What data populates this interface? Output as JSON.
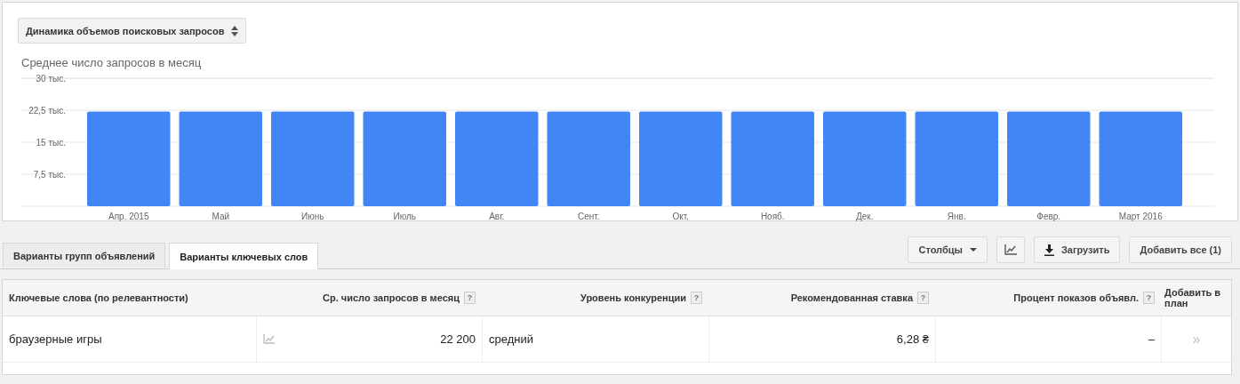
{
  "metric_select": {
    "label": "Динамика объемов поисковых запросов"
  },
  "chart": {
    "chart_data": {
      "type": "bar",
      "title": "Среднее число запросов в месяц",
      "categories": [
        "Апр. 2015",
        "Май",
        "Июнь",
        "Июль",
        "Авг.",
        "Сент.",
        "Окт.",
        "Нояб.",
        "Дек.",
        "Янв.",
        "Февр.",
        "Март 2016"
      ],
      "series": [
        {
          "color": "#4285f4",
          "values": [
            22.2,
            22.2,
            22.2,
            22.2,
            22.2,
            22.2,
            22.2,
            22.2,
            22.2,
            22.2,
            22.2,
            22.2
          ]
        }
      ],
      "ylim": [
        0,
        30
      ],
      "grid": true,
      "yticks": [
        {
          "value": 7.5,
          "label": "7,5 тыс."
        },
        {
          "value": 15,
          "label": "15 тыс."
        },
        {
          "value": 22.5,
          "label": "22,5 тыс."
        },
        {
          "value": 30,
          "label": "30 тыс."
        }
      ]
    }
  },
  "tabs": [
    {
      "label": "Варианты групп объявлений",
      "selected": false
    },
    {
      "label": "Варианты ключевых слов",
      "selected": true
    }
  ],
  "toolbar": {
    "columns_button": "Столбцы",
    "download_button": "Загрузить",
    "add_all_button": "Добавить все (1)"
  },
  "table": {
    "columns": [
      {
        "label": "Ключевые слова (по релевантности)"
      },
      {
        "label": "Ср. число запросов в месяц",
        "help": "?"
      },
      {
        "label": "Уровень конкуренции",
        "help": "?"
      },
      {
        "label": "Рекомендованная ставка",
        "help": "?"
      },
      {
        "label": "Процент показов объявл.",
        "help": "?"
      },
      {
        "label": "Добавить в план"
      }
    ],
    "rows": [
      {
        "keyword": "браузерные игры",
        "searches": "22 200",
        "competition": "средний",
        "bid": "6,28 ₴",
        "impression_share": "–",
        "add": "»"
      }
    ]
  }
}
